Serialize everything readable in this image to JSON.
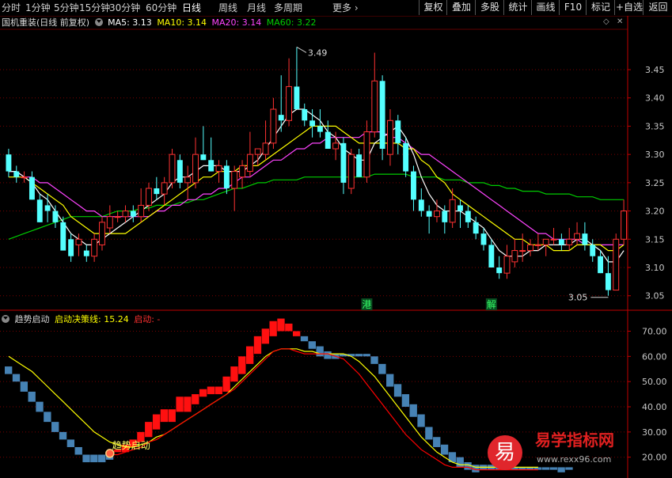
{
  "toolbar": {
    "periods": [
      "分时",
      "1分钟",
      "5分钟",
      "15分钟",
      "30分钟",
      "60分钟",
      "日线",
      "周线",
      "月线",
      "多周期",
      "更多"
    ],
    "active_period": "日线",
    "right_buttons": [
      "复权",
      "叠加",
      "多股",
      "统计",
      "画线",
      "F10",
      "标记",
      "+自选",
      "返回"
    ]
  },
  "main_legend": {
    "title": "国机重装(日线 前复权)",
    "ma5": "MA5: 3.13",
    "ma10": "MA10: 3.14",
    "ma20": "MA20: 3.14",
    "ma60": "MA60: 3.22",
    "ma5_color": "#ffffff",
    "ma10_color": "#ffff00",
    "ma20_color": "#ff44ff",
    "ma60_color": "#00cc00"
  },
  "price_axis": [
    "3.45",
    "3.40",
    "3.35",
    "3.30",
    "3.25",
    "3.20",
    "3.15",
    "3.10",
    "3.05"
  ],
  "price_annotations": {
    "high": "3.49",
    "low": "3.05"
  },
  "markers": [
    "港",
    "解"
  ],
  "sub_legend": {
    "title": "趋势启动",
    "line_label": "启动决策线: 15.24",
    "signal_label": "启动: -"
  },
  "sub_axis": [
    "70.00",
    "60.00",
    "50.00",
    "40.00",
    "30.00",
    "20.00"
  ],
  "signal_text": "趋势启动",
  "watermark": {
    "logo_char": "易",
    "brand": "易学指标网",
    "url": "www.rexx96.com"
  },
  "colors": {
    "up": "#ff3232",
    "down": "#54ffff",
    "grid": "#7a0000",
    "axis": "#c00000",
    "sub_up": "#ff1010",
    "sub_down": "#4682b4",
    "yellow": "#ffff00"
  },
  "chart_data": {
    "type": "candlestick",
    "ylim": [
      3.03,
      3.52
    ],
    "candles": [
      [
        3.3,
        3.31,
        3.26,
        3.27
      ],
      [
        3.27,
        3.28,
        3.25,
        3.26
      ],
      [
        3.26,
        3.27,
        3.25,
        3.26
      ],
      [
        3.26,
        3.27,
        3.22,
        3.22
      ],
      [
        3.22,
        3.23,
        3.18,
        3.18
      ],
      [
        3.21,
        3.23,
        3.18,
        3.2
      ],
      [
        3.2,
        3.21,
        3.17,
        3.18
      ],
      [
        3.18,
        3.19,
        3.13,
        3.13
      ],
      [
        3.15,
        3.16,
        3.11,
        3.12
      ],
      [
        3.14,
        3.16,
        3.12,
        3.15
      ],
      [
        3.13,
        3.14,
        3.11,
        3.12
      ],
      [
        3.12,
        3.16,
        3.11,
        3.15
      ],
      [
        3.14,
        3.19,
        3.13,
        3.18
      ],
      [
        3.17,
        3.21,
        3.16,
        3.19
      ],
      [
        3.19,
        3.2,
        3.18,
        3.19
      ],
      [
        3.19,
        3.21,
        3.18,
        3.2
      ],
      [
        3.2,
        3.21,
        3.18,
        3.19
      ],
      [
        3.19,
        3.24,
        3.18,
        3.21
      ],
      [
        3.21,
        3.25,
        3.2,
        3.24
      ],
      [
        3.24,
        3.26,
        3.22,
        3.23
      ],
      [
        3.23,
        3.26,
        3.21,
        3.25
      ],
      [
        3.25,
        3.31,
        3.24,
        3.3
      ],
      [
        3.29,
        3.3,
        3.24,
        3.25
      ],
      [
        3.25,
        3.28,
        3.22,
        3.26
      ],
      [
        3.25,
        3.33,
        3.24,
        3.3
      ],
      [
        3.3,
        3.35,
        3.29,
        3.29
      ],
      [
        3.29,
        3.33,
        3.27,
        3.27
      ],
      [
        3.27,
        3.29,
        3.25,
        3.28
      ],
      [
        3.28,
        3.29,
        3.23,
        3.24
      ],
      [
        3.24,
        3.28,
        3.2,
        3.27
      ],
      [
        3.26,
        3.29,
        3.24,
        3.28
      ],
      [
        3.27,
        3.34,
        3.26,
        3.3
      ],
      [
        3.3,
        3.31,
        3.28,
        3.31
      ],
      [
        3.3,
        3.36,
        3.29,
        3.32
      ],
      [
        3.32,
        3.4,
        3.31,
        3.38
      ],
      [
        3.37,
        3.44,
        3.34,
        3.36
      ],
      [
        3.36,
        3.47,
        3.35,
        3.42
      ],
      [
        3.42,
        3.49,
        3.39,
        3.38
      ],
      [
        3.38,
        3.39,
        3.35,
        3.36
      ],
      [
        3.36,
        3.38,
        3.33,
        3.35
      ],
      [
        3.35,
        3.38,
        3.33,
        3.34
      ],
      [
        3.34,
        3.36,
        3.31,
        3.31
      ],
      [
        3.31,
        3.34,
        3.29,
        3.32
      ],
      [
        3.32,
        3.33,
        3.23,
        3.25
      ],
      [
        3.24,
        3.31,
        3.23,
        3.3
      ],
      [
        3.3,
        3.31,
        3.26,
        3.26
      ],
      [
        3.26,
        3.36,
        3.25,
        3.34
      ],
      [
        3.34,
        3.48,
        3.33,
        3.43
      ],
      [
        3.43,
        3.44,
        3.29,
        3.31
      ],
      [
        3.3,
        3.38,
        3.28,
        3.36
      ],
      [
        3.36,
        3.37,
        3.3,
        3.32
      ],
      [
        3.32,
        3.33,
        3.26,
        3.27
      ],
      [
        3.27,
        3.28,
        3.2,
        3.22
      ],
      [
        3.22,
        3.24,
        3.19,
        3.2
      ],
      [
        3.2,
        3.21,
        3.16,
        3.19
      ],
      [
        3.19,
        3.22,
        3.18,
        3.2
      ],
      [
        3.2,
        3.21,
        3.16,
        3.18
      ],
      [
        3.18,
        3.24,
        3.17,
        3.22
      ],
      [
        3.21,
        3.22,
        3.17,
        3.2
      ],
      [
        3.2,
        3.21,
        3.17,
        3.18
      ],
      [
        3.18,
        3.19,
        3.15,
        3.16
      ],
      [
        3.16,
        3.17,
        3.13,
        3.14
      ],
      [
        3.14,
        3.15,
        3.1,
        3.1
      ],
      [
        3.1,
        3.12,
        3.08,
        3.09
      ],
      [
        3.09,
        3.14,
        3.08,
        3.12
      ],
      [
        3.11,
        3.15,
        3.1,
        3.13
      ],
      [
        3.13,
        3.16,
        3.11,
        3.13
      ],
      [
        3.13,
        3.15,
        3.12,
        3.14
      ],
      [
        3.14,
        3.16,
        3.13,
        3.14
      ],
      [
        3.14,
        3.15,
        3.12,
        3.15
      ],
      [
        3.15,
        3.17,
        3.14,
        3.15
      ],
      [
        3.15,
        3.16,
        3.13,
        3.14
      ],
      [
        3.14,
        3.17,
        3.13,
        3.15
      ],
      [
        3.15,
        3.18,
        3.14,
        3.16
      ],
      [
        3.16,
        3.18,
        3.13,
        3.14
      ],
      [
        3.14,
        3.15,
        3.11,
        3.12
      ],
      [
        3.12,
        3.13,
        3.09,
        3.09
      ],
      [
        3.09,
        3.12,
        3.05,
        3.06
      ],
      [
        3.06,
        3.16,
        3.06,
        3.15
      ],
      [
        3.15,
        3.22,
        3.14,
        3.2
      ]
    ],
    "ma5": [
      3.27,
      3.27,
      3.26,
      3.25,
      3.23,
      3.22,
      3.2,
      3.18,
      3.16,
      3.15,
      3.14,
      3.14,
      3.15,
      3.16,
      3.17,
      3.18,
      3.19,
      3.2,
      3.21,
      3.22,
      3.23,
      3.25,
      3.26,
      3.26,
      3.27,
      3.28,
      3.28,
      3.28,
      3.27,
      3.27,
      3.27,
      3.28,
      3.29,
      3.31,
      3.33,
      3.35,
      3.37,
      3.38,
      3.38,
      3.37,
      3.36,
      3.34,
      3.33,
      3.31,
      3.3,
      3.29,
      3.29,
      3.32,
      3.33,
      3.34,
      3.35,
      3.33,
      3.3,
      3.26,
      3.23,
      3.21,
      3.2,
      3.2,
      3.2,
      3.19,
      3.18,
      3.17,
      3.15,
      3.13,
      3.12,
      3.12,
      3.12,
      3.13,
      3.13,
      3.14,
      3.14,
      3.14,
      3.14,
      3.15,
      3.15,
      3.14,
      3.13,
      3.11,
      3.11,
      3.13
    ],
    "ma10": [
      3.26,
      3.26,
      3.26,
      3.25,
      3.24,
      3.23,
      3.22,
      3.21,
      3.19,
      3.18,
      3.17,
      3.16,
      3.16,
      3.16,
      3.16,
      3.16,
      3.17,
      3.18,
      3.19,
      3.2,
      3.21,
      3.22,
      3.23,
      3.24,
      3.25,
      3.26,
      3.26,
      3.27,
      3.27,
      3.27,
      3.28,
      3.28,
      3.28,
      3.29,
      3.3,
      3.31,
      3.32,
      3.33,
      3.34,
      3.35,
      3.35,
      3.35,
      3.35,
      3.34,
      3.33,
      3.32,
      3.32,
      3.32,
      3.32,
      3.32,
      3.32,
      3.31,
      3.31,
      3.29,
      3.28,
      3.26,
      3.25,
      3.23,
      3.22,
      3.21,
      3.2,
      3.19,
      3.18,
      3.17,
      3.16,
      3.15,
      3.15,
      3.14,
      3.14,
      3.14,
      3.13,
      3.13,
      3.13,
      3.14,
      3.14,
      3.14,
      3.14,
      3.13,
      3.13,
      3.14
    ],
    "ma20": [
      3.27,
      3.27,
      3.26,
      3.26,
      3.25,
      3.25,
      3.24,
      3.23,
      3.22,
      3.21,
      3.2,
      3.2,
      3.19,
      3.19,
      3.19,
      3.19,
      3.19,
      3.19,
      3.19,
      3.2,
      3.2,
      3.21,
      3.21,
      3.22,
      3.22,
      3.23,
      3.23,
      3.24,
      3.24,
      3.25,
      3.26,
      3.26,
      3.27,
      3.28,
      3.29,
      3.29,
      3.3,
      3.31,
      3.31,
      3.32,
      3.32,
      3.33,
      3.33,
      3.33,
      3.33,
      3.33,
      3.34,
      3.34,
      3.34,
      3.33,
      3.33,
      3.32,
      3.31,
      3.3,
      3.3,
      3.29,
      3.28,
      3.27,
      3.26,
      3.25,
      3.24,
      3.23,
      3.22,
      3.21,
      3.2,
      3.19,
      3.18,
      3.17,
      3.16,
      3.16,
      3.15,
      3.15,
      3.15,
      3.15,
      3.14,
      3.14,
      3.14,
      3.14,
      3.14,
      3.14
    ],
    "ma60": [
      3.15,
      3.155,
      3.16,
      3.165,
      3.17,
      3.175,
      3.18,
      3.185,
      3.19,
      3.19,
      3.19,
      3.19,
      3.19,
      3.195,
      3.2,
      3.2,
      3.2,
      3.205,
      3.205,
      3.21,
      3.21,
      3.21,
      3.215,
      3.215,
      3.22,
      3.22,
      3.225,
      3.23,
      3.235,
      3.24,
      3.24,
      3.245,
      3.25,
      3.25,
      3.255,
      3.255,
      3.255,
      3.255,
      3.26,
      3.26,
      3.26,
      3.26,
      3.26,
      3.26,
      3.26,
      3.26,
      3.26,
      3.265,
      3.265,
      3.265,
      3.265,
      3.265,
      3.26,
      3.26,
      3.26,
      3.26,
      3.255,
      3.255,
      3.255,
      3.25,
      3.25,
      3.25,
      3.245,
      3.245,
      3.24,
      3.24,
      3.235,
      3.235,
      3.235,
      3.23,
      3.23,
      3.23,
      3.23,
      3.225,
      3.225,
      3.225,
      3.22,
      3.22,
      3.22,
      3.22
    ],
    "sub_bars": [
      [
        56,
        53,
        "d"
      ],
      [
        53,
        50,
        "d"
      ],
      [
        50,
        46,
        "d"
      ],
      [
        46,
        42,
        "d"
      ],
      [
        42,
        38,
        "d"
      ],
      [
        38,
        34,
        "d"
      ],
      [
        34,
        30,
        "d"
      ],
      [
        30,
        27,
        "d"
      ],
      [
        27,
        24,
        "d"
      ],
      [
        24,
        21,
        "d"
      ],
      [
        21,
        18,
        "d"
      ],
      [
        21,
        18,
        "d"
      ],
      [
        21,
        18,
        "d"
      ],
      [
        21,
        19,
        "d"
      ],
      [
        23,
        22,
        "u"
      ],
      [
        25,
        22,
        "u"
      ],
      [
        27,
        24,
        "u"
      ],
      [
        30,
        26,
        "u"
      ],
      [
        34,
        28,
        "u"
      ],
      [
        37,
        31,
        "u"
      ],
      [
        39,
        34,
        "u"
      ],
      [
        39,
        34,
        "u"
      ],
      [
        44,
        38,
        "u"
      ],
      [
        44,
        38,
        "u"
      ],
      [
        45,
        41,
        "u"
      ],
      [
        47,
        44,
        "u"
      ],
      [
        48,
        45,
        "u"
      ],
      [
        48,
        45,
        "u"
      ],
      [
        52,
        46,
        "u"
      ],
      [
        56,
        50,
        "u"
      ],
      [
        60,
        53,
        "u"
      ],
      [
        64,
        57,
        "u"
      ],
      [
        68,
        61,
        "u"
      ],
      [
        71,
        65,
        "u"
      ],
      [
        74,
        68,
        "u"
      ],
      [
        75,
        70,
        "u"
      ],
      [
        73,
        70,
        "u"
      ],
      [
        70,
        68,
        "u"
      ],
      [
        68,
        66,
        "d"
      ],
      [
        66,
        63,
        "d"
      ],
      [
        64,
        60,
        "d"
      ],
      [
        62,
        59,
        "d"
      ],
      [
        61,
        59,
        "d"
      ],
      [
        61,
        60,
        "d"
      ],
      [
        61,
        60,
        "d"
      ],
      [
        61,
        60,
        "d"
      ],
      [
        61,
        60,
        "d"
      ],
      [
        60,
        57,
        "d"
      ],
      [
        57,
        53,
        "d"
      ],
      [
        53,
        48,
        "d"
      ],
      [
        49,
        44,
        "d"
      ],
      [
        45,
        40,
        "d"
      ],
      [
        41,
        36,
        "d"
      ],
      [
        37,
        32,
        "d"
      ],
      [
        32,
        27,
        "d"
      ],
      [
        28,
        24,
        "d"
      ],
      [
        25,
        21,
        "d"
      ],
      [
        22,
        18,
        "d"
      ],
      [
        20,
        16,
        "d"
      ],
      [
        18,
        15,
        "d"
      ],
      [
        17,
        14,
        "d"
      ],
      [
        17,
        15,
        "d"
      ],
      [
        17,
        15,
        "d"
      ],
      [
        16,
        15,
        "d"
      ],
      [
        16,
        15,
        "d"
      ],
      [
        16,
        15,
        "d"
      ],
      [
        16,
        15,
        "d"
      ],
      [
        16,
        15,
        "d"
      ],
      [
        16,
        15,
        "d"
      ],
      [
        16,
        15,
        "d"
      ],
      [
        16,
        15,
        "d"
      ],
      [
        16,
        14,
        "d"
      ],
      [
        16,
        15,
        "d"
      ]
    ],
    "sub_yellow": [
      60,
      58,
      56,
      54,
      51,
      48,
      45,
      42,
      39,
      36,
      33,
      30,
      28,
      26,
      25,
      24,
      24,
      25,
      26,
      28,
      29,
      31,
      33,
      35,
      37,
      39,
      41,
      43,
      45,
      48,
      51,
      54,
      57,
      60,
      62,
      63,
      63,
      63,
      62,
      62,
      61,
      61,
      61,
      61,
      60,
      58,
      55,
      52,
      48,
      44,
      40,
      36,
      32,
      28,
      25,
      22,
      20,
      18,
      17,
      17,
      16,
      16,
      16,
      16,
      16,
      16,
      16,
      16,
      16
    ],
    "sub_red": [
      21,
      21,
      22,
      23,
      24,
      26,
      27,
      29,
      31,
      33,
      35,
      37,
      39,
      41,
      43,
      45,
      47,
      50,
      53,
      56,
      59,
      62,
      63,
      63,
      62,
      61,
      61,
      61,
      61,
      60,
      59,
      56,
      53,
      49,
      45,
      41,
      37,
      33,
      29,
      26,
      23,
      21,
      19,
      17,
      16,
      16,
      16,
      15,
      15,
      15,
      15,
      15,
      15,
      15,
      15,
      15
    ]
  }
}
